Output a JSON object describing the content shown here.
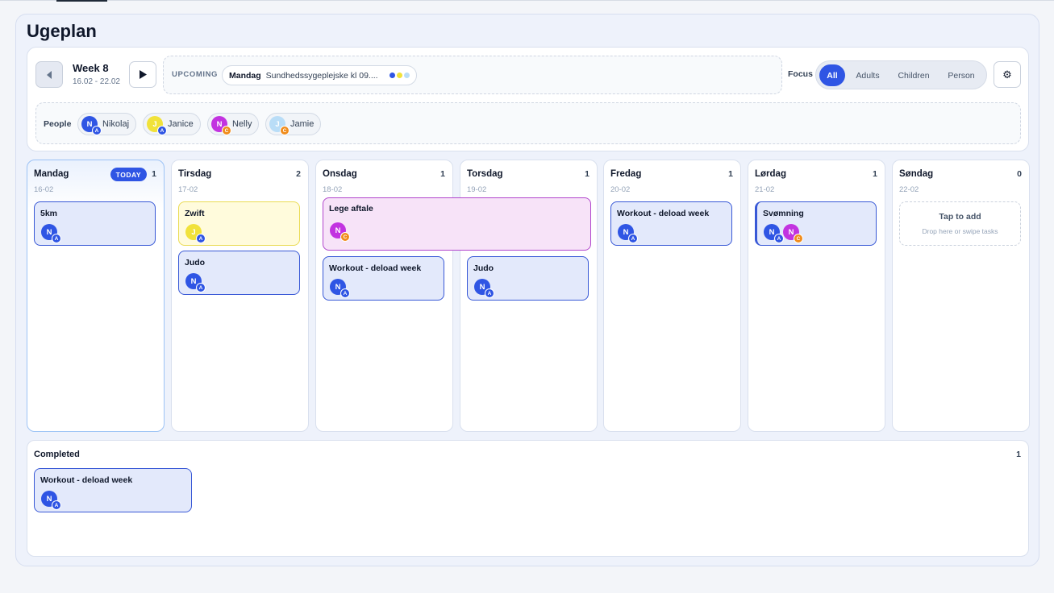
{
  "colors": {
    "accent": "#2f55e4",
    "adult_badge": "#2f55e4",
    "child_badge": "#f08c1c",
    "nikolaj": "#2f55e4",
    "janice": "#f1e23a",
    "nelly": "#c233e0",
    "jamie": "#b9ddf7"
  },
  "page": {
    "title": "Ugeplan"
  },
  "week": {
    "label": "Week 8",
    "range": "16.02 - 22.02"
  },
  "upcoming": {
    "label": "UPCOMING",
    "day": "Mandag",
    "text": "Sundhedssygeplejske kl 09....",
    "dot_colors": [
      "#2f55e4",
      "#f1e23a",
      "#b9ddf7"
    ]
  },
  "focus": {
    "label": "Focus",
    "options": [
      "All",
      "Adults",
      "Children",
      "Person"
    ],
    "selected": "All"
  },
  "settings": {
    "icon": "gear-icon"
  },
  "people": {
    "label": "People",
    "list": [
      {
        "name": "Nikolaj",
        "initial": "N",
        "badge": "A"
      },
      {
        "name": "Janice",
        "initial": "J",
        "badge": "A"
      },
      {
        "name": "Nelly",
        "initial": "N",
        "badge": "C"
      },
      {
        "name": "Jamie",
        "initial": "J",
        "badge": "C"
      }
    ]
  },
  "days": [
    {
      "name": "Mandag",
      "date": "16-02",
      "count": "1",
      "today_label": "TODAY",
      "tasks": [
        {
          "title": "5km",
          "people": [
            {
              "initial": "N",
              "badge": "A"
            }
          ]
        }
      ]
    },
    {
      "name": "Tirsdag",
      "date": "17-02",
      "count": "2",
      "tasks": [
        {
          "title": "Zwift",
          "people": [
            {
              "initial": "J",
              "badge": "A"
            }
          ]
        },
        {
          "title": "Judo",
          "people": [
            {
              "initial": "N",
              "badge": "A"
            }
          ]
        }
      ]
    },
    {
      "name": "Onsdag",
      "date": "18-02",
      "count": "1",
      "tasks": [
        {
          "title": "Lege aftale",
          "people": [
            {
              "initial": "N",
              "badge": "C"
            }
          ]
        },
        {
          "title": "Workout - deload week",
          "people": [
            {
              "initial": "N",
              "badge": "A"
            }
          ]
        }
      ]
    },
    {
      "name": "Torsdag",
      "date": "19-02",
      "count": "1",
      "tasks": [
        {
          "title": "Judo",
          "people": [
            {
              "initial": "N",
              "badge": "A"
            }
          ]
        }
      ]
    },
    {
      "name": "Fredag",
      "date": "20-02",
      "count": "1",
      "tasks": [
        {
          "title": "Workout - deload week",
          "people": [
            {
              "initial": "N",
              "badge": "A"
            }
          ]
        }
      ]
    },
    {
      "name": "Lørdag",
      "date": "21-02",
      "count": "1",
      "tasks": [
        {
          "title": "Svømning",
          "people": [
            {
              "initial": "N",
              "badge": "A"
            },
            {
              "initial": "N",
              "badge": "C"
            }
          ]
        }
      ]
    },
    {
      "name": "Søndag",
      "date": "22-02",
      "count": "0",
      "empty": {
        "title": "Tap to add",
        "sub": "Drop here or swipe tasks"
      }
    }
  ],
  "completed": {
    "label": "Completed",
    "count": "1",
    "tasks": [
      {
        "title": "Workout - deload week",
        "people": [
          {
            "initial": "N",
            "badge": "A"
          }
        ]
      }
    ]
  }
}
